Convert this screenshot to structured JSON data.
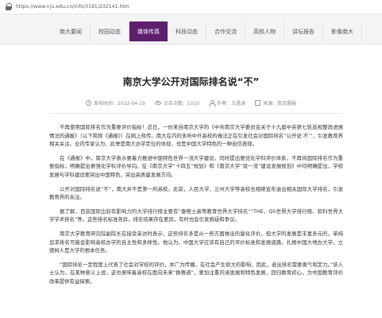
{
  "browser": {
    "url": "https://www.nju.edu.cn/info/3191/232141.htm"
  },
  "nav": {
    "items": [
      {
        "label": "南大要闻",
        "active": false
      },
      {
        "label": "校园动态",
        "active": false
      },
      {
        "label": "媒体传真",
        "active": true
      },
      {
        "label": "科技动态",
        "active": false
      },
      {
        "label": "合作交流",
        "active": false
      },
      {
        "label": "高校人物",
        "active": false
      },
      {
        "label": "讲坛报告",
        "active": false
      },
      {
        "label": "影像南大",
        "active": false
      }
    ]
  },
  "article": {
    "title": "南京大学公开对国际排名说“不”",
    "date": "发布时间：2022-04-19",
    "views": "点击次数：1010",
    "author": "作者：王晶涛",
    "source": "来源：南京晨报",
    "paragraphs": [
      "不再使用国际排名作为重要评价指标！近日，一份来自南京大学的《中共南京大学委员会关于十九届中央第七轮巡视整改进展情况的通报》（以下简称《通报》）在网上热传。南大在内的多所中外高校的做法正在引发社会对国际排名“公开说‘不’”，引发教育界相关关注。业内专家认为，此举是南大办学定位的体现，也是中国大学特色的一种自信表现。",
      "在《通报》中，南京大学表示要着力推进中国特色世界一流大学建设，同时提出要优化学科评价体系，不再将国际排名作为重要指标，明确提出要强化学科评价导向。在《南京大学“十四五”规划》和《南京大学“双一流”建设发展规划》中均明确提出，学校发展与学科建设要突出中国特色，突出高质量发展方向。",
      "公开对国际排名说“不”，南大并不是第一所高校。此前，人民大学、兰州大学等高校也相继宣布退出相关国际大学排名，引发教育界的关注。",
      "据了解，目前国际比较有影响力的大学排行榜主要有“泰晤士高等教育世界大学排名”“THE、QS世界大学排行榜、软科世界大学学术排名”等。这些排名标准各异，排名结果存在差异，有时也会引发质疑和争议。",
      "南京大学教育研究院副院长在接受采访时表示，这些排名多是从一些方面做出的量化评价，但大学的发展是丰富多元的，单纯追求排名可能会影响高校办学的自主性和多样性。他认为，中国大学应该有自己的评价标准和发展道路，扎根中国大地办大学，立德树人是大学的根本任务。",
      "“国际排名一定程度上代表了社会对学校的评价，并广为传播，在社会产生很大的影响，因此，退出排名需要勇气和定力。”该人士认为，在某种意义上说，这也意味着高校在面向未来“换赛道”，更加注重内涵发展和特色发展，回归教育初心，为中国教育评价改革提供有益探索。"
    ]
  }
}
